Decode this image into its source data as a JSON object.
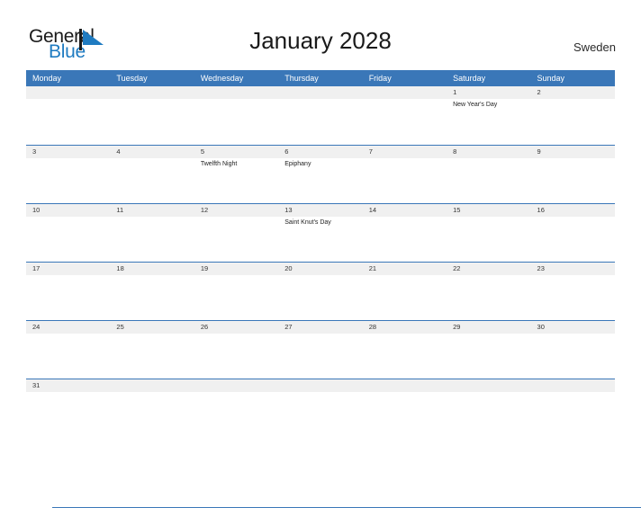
{
  "brand": {
    "word_one": "General",
    "word_two": "Blue",
    "flag_icon": "flag-triangle-icon",
    "flag_color": "#1f7bc1",
    "pole_color": "#1a1a1a"
  },
  "header": {
    "title": "January 2028",
    "country": "Sweden"
  },
  "theme": {
    "header_blue": "#3a77b8",
    "rule_blue": "#3a77b8",
    "day_band_gray": "#f0f0f0",
    "brand_blue": "#1f7bc1"
  },
  "calendar": {
    "weekdays": [
      "Monday",
      "Tuesday",
      "Wednesday",
      "Thursday",
      "Friday",
      "Saturday",
      "Sunday"
    ],
    "weeks": [
      {
        "days": [
          {
            "date": "",
            "events": []
          },
          {
            "date": "",
            "events": []
          },
          {
            "date": "",
            "events": []
          },
          {
            "date": "",
            "events": []
          },
          {
            "date": "",
            "events": []
          },
          {
            "date": "1",
            "events": [
              "New Year's Day"
            ]
          },
          {
            "date": "2",
            "events": []
          }
        ]
      },
      {
        "days": [
          {
            "date": "3",
            "events": []
          },
          {
            "date": "4",
            "events": []
          },
          {
            "date": "5",
            "events": [
              "Twelfth Night"
            ]
          },
          {
            "date": "6",
            "events": [
              "Epiphany"
            ]
          },
          {
            "date": "7",
            "events": []
          },
          {
            "date": "8",
            "events": []
          },
          {
            "date": "9",
            "events": []
          }
        ]
      },
      {
        "days": [
          {
            "date": "10",
            "events": []
          },
          {
            "date": "11",
            "events": []
          },
          {
            "date": "12",
            "events": []
          },
          {
            "date": "13",
            "events": [
              "Saint Knut's Day"
            ]
          },
          {
            "date": "14",
            "events": []
          },
          {
            "date": "15",
            "events": []
          },
          {
            "date": "16",
            "events": []
          }
        ]
      },
      {
        "days": [
          {
            "date": "17",
            "events": []
          },
          {
            "date": "18",
            "events": []
          },
          {
            "date": "19",
            "events": []
          },
          {
            "date": "20",
            "events": []
          },
          {
            "date": "21",
            "events": []
          },
          {
            "date": "22",
            "events": []
          },
          {
            "date": "23",
            "events": []
          }
        ]
      },
      {
        "days": [
          {
            "date": "24",
            "events": []
          },
          {
            "date": "25",
            "events": []
          },
          {
            "date": "26",
            "events": []
          },
          {
            "date": "27",
            "events": []
          },
          {
            "date": "28",
            "events": []
          },
          {
            "date": "29",
            "events": []
          },
          {
            "date": "30",
            "events": []
          }
        ]
      },
      {
        "days": [
          {
            "date": "31",
            "events": []
          },
          {
            "date": "",
            "events": []
          },
          {
            "date": "",
            "events": []
          },
          {
            "date": "",
            "events": []
          },
          {
            "date": "",
            "events": []
          },
          {
            "date": "",
            "events": []
          },
          {
            "date": "",
            "events": []
          }
        ]
      }
    ]
  }
}
